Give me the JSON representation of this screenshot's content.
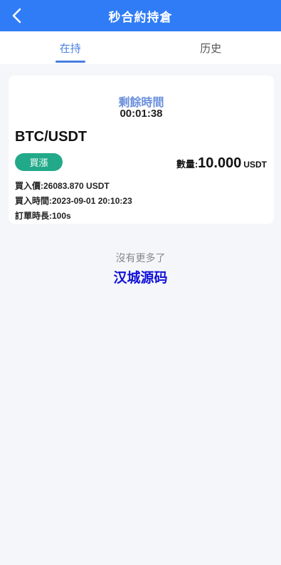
{
  "header": {
    "title": "秒合約持倉",
    "back_icon": "chevron-left-icon"
  },
  "tabs": [
    {
      "label": "在持",
      "active": true
    },
    {
      "label": "历史",
      "active": false
    }
  ],
  "order": {
    "remaining_label": "剩餘時間",
    "remaining_time": "00:01:38",
    "pair": "BTC/USDT",
    "direction": "買漲",
    "quantity_label": "數量:",
    "quantity_value": "10.000",
    "quantity_unit": "USDT",
    "buy_price": "買入價:26083.870 USDT",
    "buy_time": "買入時間:2023-09-01 20:10:23",
    "duration": "訂單時長:100s"
  },
  "footer": {
    "empty_text": "沒有更多了",
    "brand_text": "汉城源码"
  },
  "colors": {
    "header_bg": "#2f7cf6",
    "tab_active": "#4a7fe0",
    "badge_bg": "#22a98a",
    "brand": "#1010d8"
  }
}
